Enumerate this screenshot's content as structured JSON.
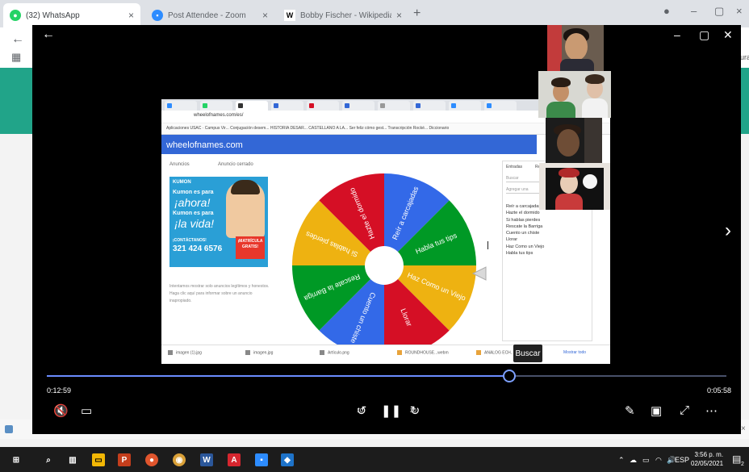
{
  "browser": {
    "tabs": [
      {
        "title": "(32) WhatsApp",
        "icon": "whatsapp-icon",
        "color": "#25d366"
      },
      {
        "title": "Post Attendee - Zoom",
        "icon": "zoom-icon",
        "color": "#2d8cff"
      },
      {
        "title": "Bobby Fischer - Wikipedia, la en",
        "icon": "wikipedia-icon",
        "color": "#ffffff"
      }
    ],
    "new_tab": "+"
  },
  "player": {
    "time_elapsed": "0:12:59",
    "time_total": "0:05:58",
    "progress": 0.68,
    "skip_back_label": "10",
    "skip_fwd_label": "30"
  },
  "shared_screen": {
    "address": "wheelofnames.com/es/",
    "bookmarks": "Aplicaciones   USAC · Campus Vir...   Conjugación desem...   HISTORIA DESAR...   CASTELLANO A LA...   Ser feliz cómo gest...   Transcripción Rocké...   Diccionario",
    "site_title": "wheelofnames.com",
    "ads_label": "Anuncios",
    "ads_close": "Anuncio cerrado",
    "ad": {
      "brand": "KUMON",
      "line1": "Kumon es para",
      "line2": "¡ahora!",
      "line3": "Kumon es para",
      "line4": "¡la vida!",
      "contact": "¡CONTÁCTANOS!",
      "phone": "321 424 6576",
      "badge": "¡MATRÍCULA GRATIS!"
    },
    "info_text": "Intentamos mostrar solo anuncios legítimos y honestos. Haga clic aquí para informar sobre un anuncio inapropiado.",
    "wheel_segments": [
      {
        "label": "Reír a carcajadas",
        "color": "#3369e8"
      },
      {
        "label": "Habla tus tips",
        "color": "#009925"
      },
      {
        "label": "Haz Como un Viejo",
        "color": "#eeb211"
      },
      {
        "label": "Llorar",
        "color": "#d50f25"
      },
      {
        "label": "Cuento un chiste",
        "color": "#3369e8"
      },
      {
        "label": "Rescate la Barriga",
        "color": "#009925"
      },
      {
        "label": "Si hablas pierdes",
        "color": "#eeb211"
      },
      {
        "label": "Hazte el dormido",
        "color": "#d50f25"
      }
    ],
    "names_panel": {
      "tab1": "Entradas",
      "tab2": "Resultados",
      "input_placeholder": "Buscar",
      "input2_placeholder": "Agregar una",
      "names": [
        "Reír a carcajadas",
        "Hazte el dormido",
        "Si hablas pierdes",
        "Rescate la Barriga",
        "Cuento un chiste",
        "Llorar",
        "Haz Como un Viejo",
        "Habla tus tips"
      ]
    },
    "downloads": [
      "imagen (1).jpg",
      "imagen.jpg",
      "Artículo.png",
      "ROUNDHOUSE...webm",
      "ANALOG ECH...webm"
    ],
    "downloads_more": "Mostrar todo"
  },
  "tooltip": "Buscar",
  "taskbar": {
    "language": "ESP",
    "time": "3:56 p. m.",
    "date": "02/05/2021",
    "notifications": "2"
  }
}
